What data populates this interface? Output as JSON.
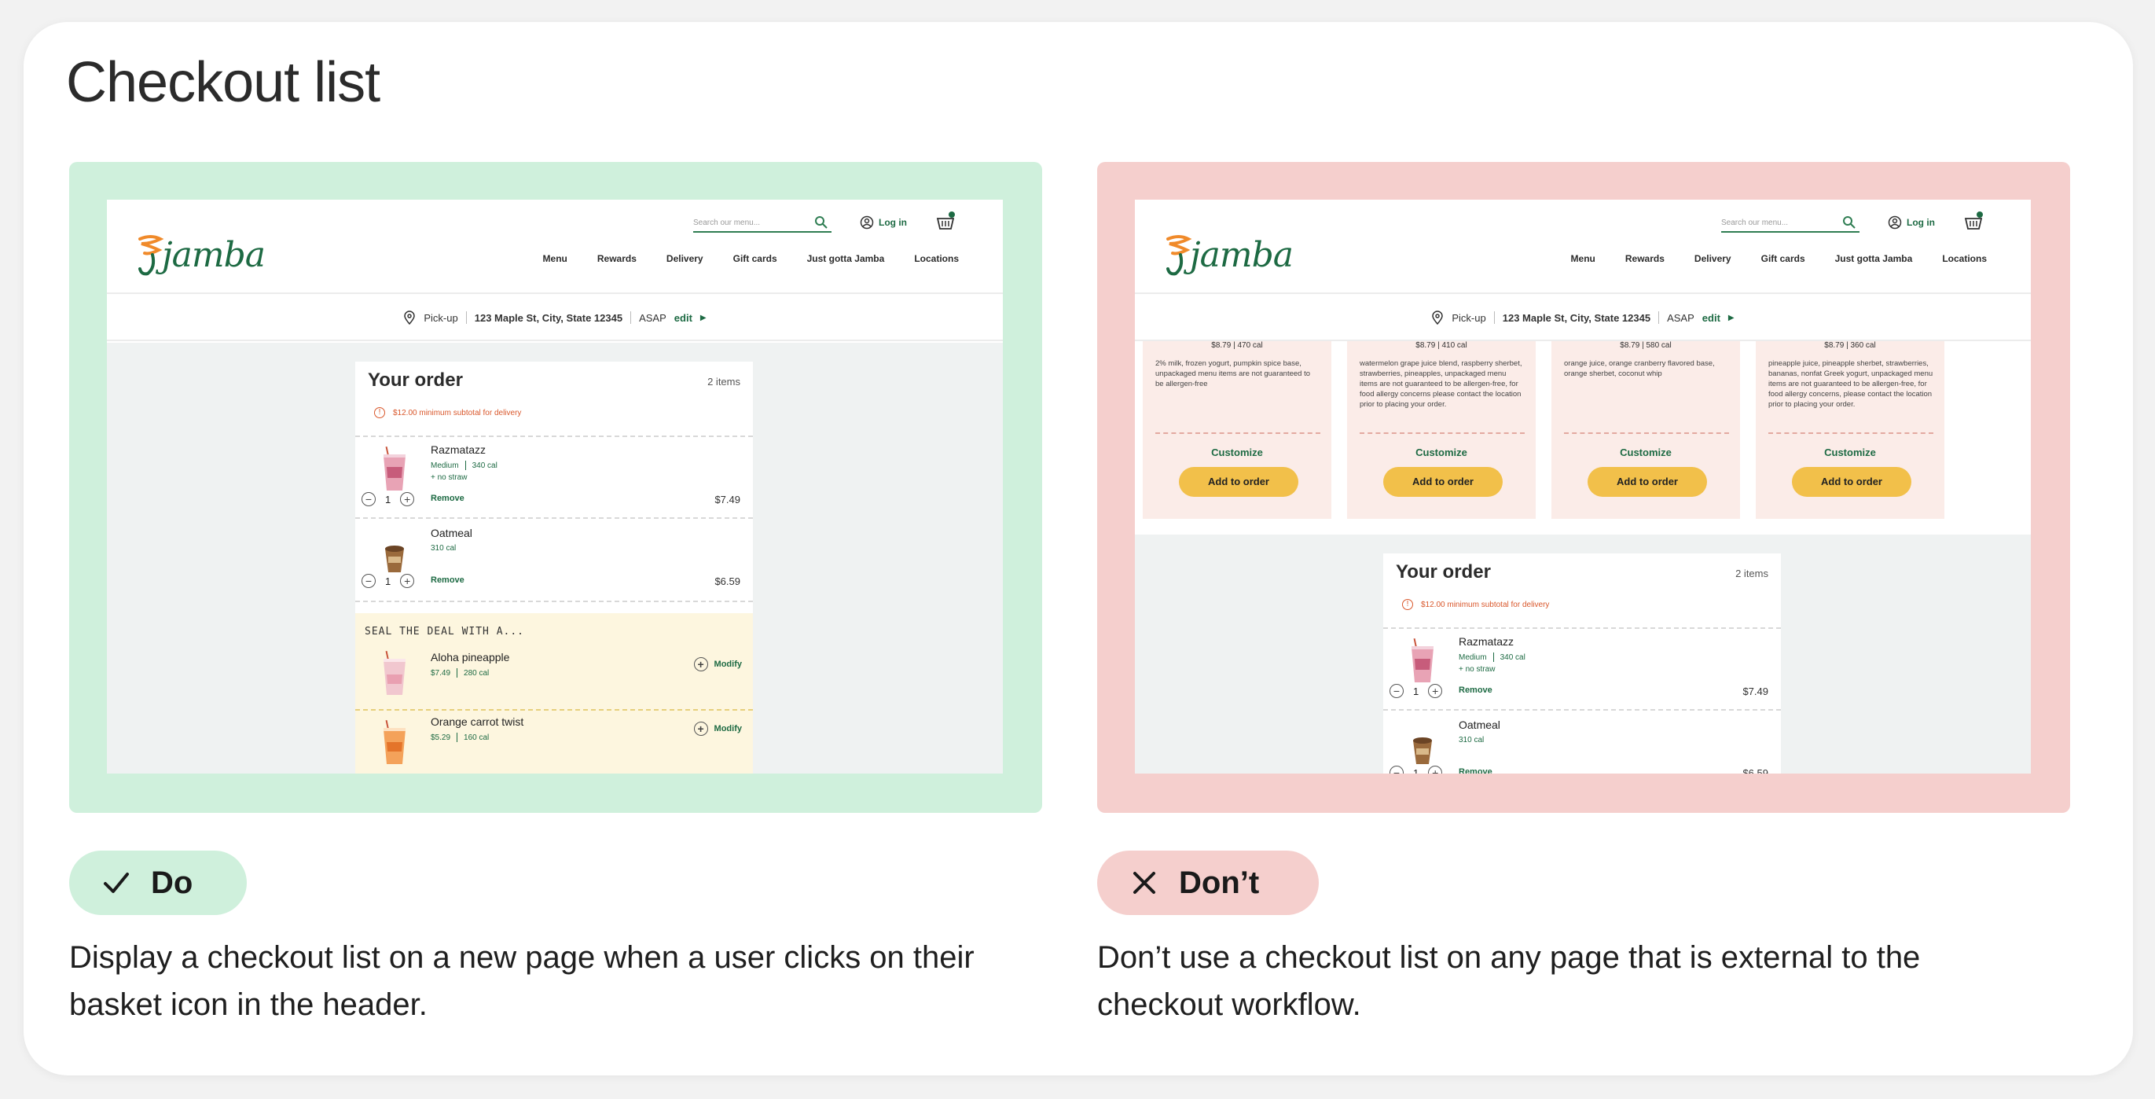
{
  "title": "Checkout list",
  "colors": {
    "do_bg": "#cff0dc",
    "dont_bg": "#f5cfcd",
    "brand_green": "#1d6a43",
    "accent_orange": "#d9572b",
    "button_yellow": "#f2c04a"
  },
  "header": {
    "logo_text": "jamba",
    "search_placeholder": "Search our menu...",
    "login": "Log in",
    "nav": [
      "Menu",
      "Rewards",
      "Delivery",
      "Gift cards",
      "Just gotta Jamba",
      "Locations"
    ]
  },
  "pickup": {
    "mode": "Pick-up",
    "address": "123 Maple St, City, State 12345",
    "time": "ASAP",
    "edit": "edit"
  },
  "order": {
    "title": "Your order",
    "count": "2 items",
    "warning": "$12.00 minimum subtotal for delivery",
    "items": [
      {
        "name": "Razmatazz",
        "size": "Medium",
        "cal": "340 cal",
        "extra": "+ no straw",
        "qty": "1",
        "remove": "Remove",
        "price": "$7.49"
      },
      {
        "name": "Oatmeal",
        "cal": "310 cal",
        "qty": "1",
        "remove": "Remove",
        "price": "$6.59"
      }
    ],
    "deal": {
      "title": "SEAL THE DEAL WITH A...",
      "items": [
        {
          "name": "Aloha pineapple",
          "price": "$7.49",
          "cal": "280 cal",
          "action": "Modify"
        },
        {
          "name": "Orange carrot twist",
          "price": "$5.29",
          "cal": "160 cal",
          "action": "Modify"
        }
      ]
    }
  },
  "menu_cards": [
    {
      "price": "$8.79",
      "cal": "470 cal",
      "desc": "2% milk, frozen yogurt, pumpkin spice base, unpackaged menu items are not guaranteed to be allergen-free",
      "customize": "Customize",
      "add": "Add to order"
    },
    {
      "price": "$8.79",
      "cal": "410 cal",
      "desc": "watermelon grape juice blend, raspberry sherbet, strawberries, pineapples, unpackaged menu items are not guaranteed to be allergen-free, for food allergy concerns please contact the location prior to placing your order.",
      "customize": "Customize",
      "add": "Add to order"
    },
    {
      "price": "$8.79",
      "cal": "580 cal",
      "desc": "orange juice, orange cranberry flavored base, orange sherbet, coconut whip",
      "customize": "Customize",
      "add": "Add to order"
    },
    {
      "price": "$8.79",
      "cal": "360 cal",
      "desc": "pineapple juice, pineapple sherbet, strawberries, bananas, nonfat Greek yogurt, unpackaged menu items are not guaranteed to be allergen-free, for food allergy concerns, please contact the location prior to placing your order.",
      "customize": "Customize",
      "add": "Add to order"
    }
  ],
  "do": {
    "label": "Do",
    "caption": "Display a checkout list on a new page when a user clicks on their basket icon in the header."
  },
  "dont": {
    "label": "Don’t",
    "caption": "Don’t use a checkout list on any page that is external to the checkout workflow."
  }
}
